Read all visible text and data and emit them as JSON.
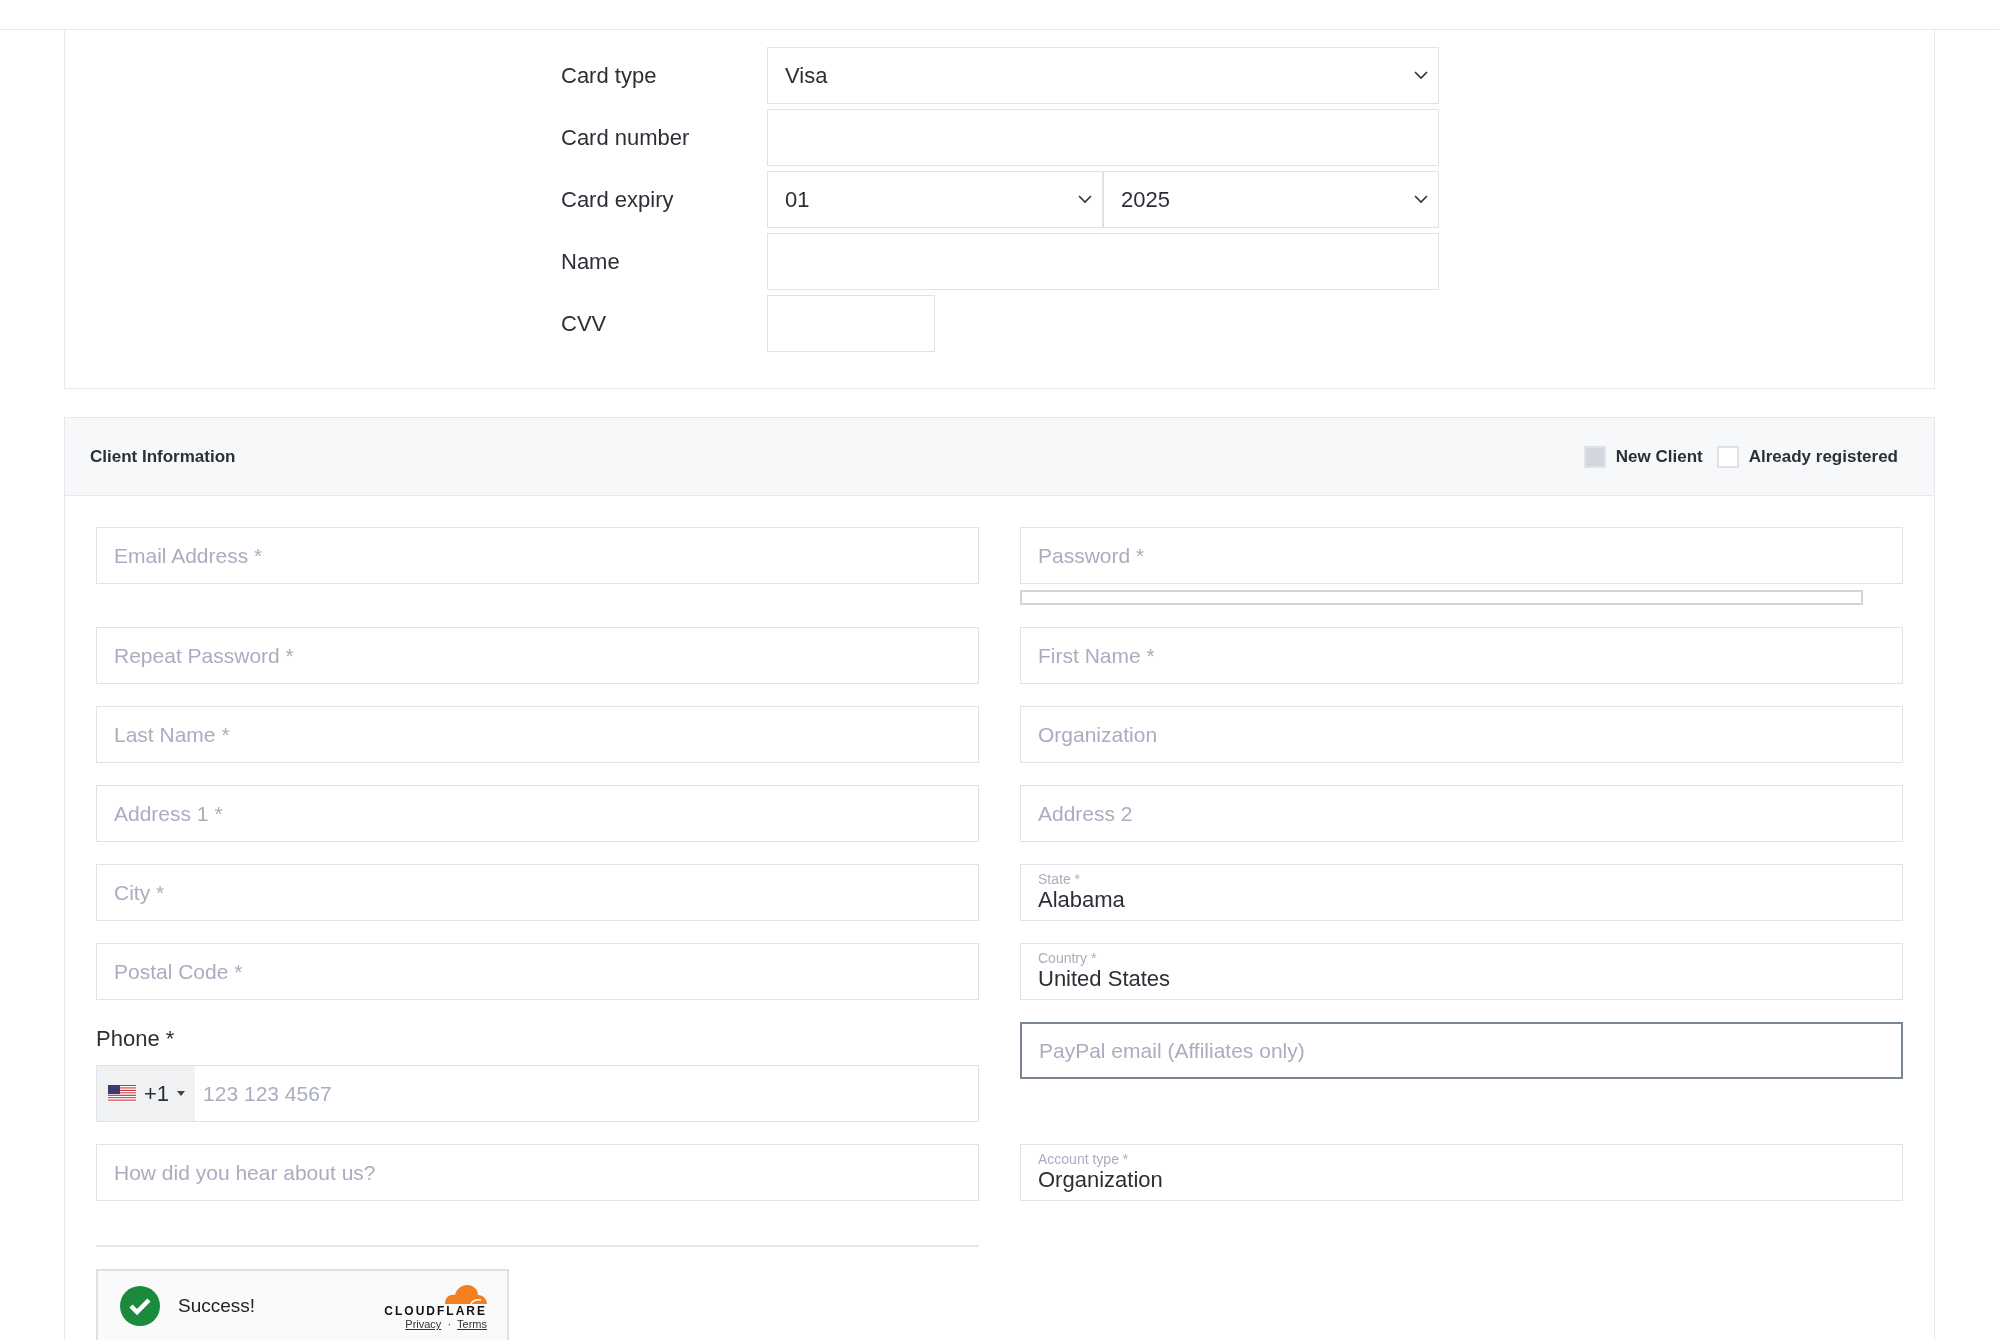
{
  "card_details": {
    "fields": [
      {
        "label": "Card type",
        "kind": "select",
        "values": [
          "Visa"
        ]
      },
      {
        "label": "Card number",
        "kind": "input"
      },
      {
        "label": "Card expiry",
        "kind": "select",
        "values": [
          "01",
          "2025"
        ]
      },
      {
        "label": "Name",
        "kind": "input"
      },
      {
        "label": "CVV",
        "kind": "short_input"
      }
    ]
  },
  "client_info": {
    "title": "Client Information",
    "options": [
      {
        "label": "New Client",
        "checked": true
      },
      {
        "label": "Already registered",
        "checked": false
      }
    ],
    "fields": [
      {
        "kind": "input",
        "placeholder": "Email Address *"
      },
      {
        "kind": "password",
        "placeholder": "Password *",
        "strength": {
          "level": 0
        }
      },
      {
        "kind": "input",
        "placeholder": "Repeat Password *"
      },
      {
        "kind": "input",
        "placeholder": "First Name *"
      },
      {
        "kind": "input",
        "placeholder": "Last Name *"
      },
      {
        "kind": "input",
        "placeholder": "Organization"
      },
      {
        "kind": "input",
        "placeholder": "Address 1 *"
      },
      {
        "kind": "input",
        "placeholder": "Address 2"
      },
      {
        "kind": "input",
        "placeholder": "City *"
      },
      {
        "kind": "floating",
        "label": "State *",
        "value": "Alabama"
      },
      {
        "kind": "input",
        "placeholder": "Postal Code *"
      },
      {
        "kind": "floating",
        "label": "Country *",
        "value": "United States"
      },
      {
        "kind": "phone",
        "label": "Phone *",
        "dial_code": "+1",
        "placeholder": "123 123 4567"
      },
      {
        "kind": "input",
        "placeholder": "PayPal email (Affiliates only)",
        "focused": true
      },
      {
        "kind": "input",
        "placeholder": "How did you hear about us?"
      },
      {
        "kind": "floating",
        "label": "Account type *",
        "value": "Organization"
      }
    ],
    "captcha": {
      "status": "Success!",
      "brand": "CLOUDFLARE",
      "links": [
        "Privacy",
        "Terms"
      ],
      "separator": "·"
    }
  }
}
